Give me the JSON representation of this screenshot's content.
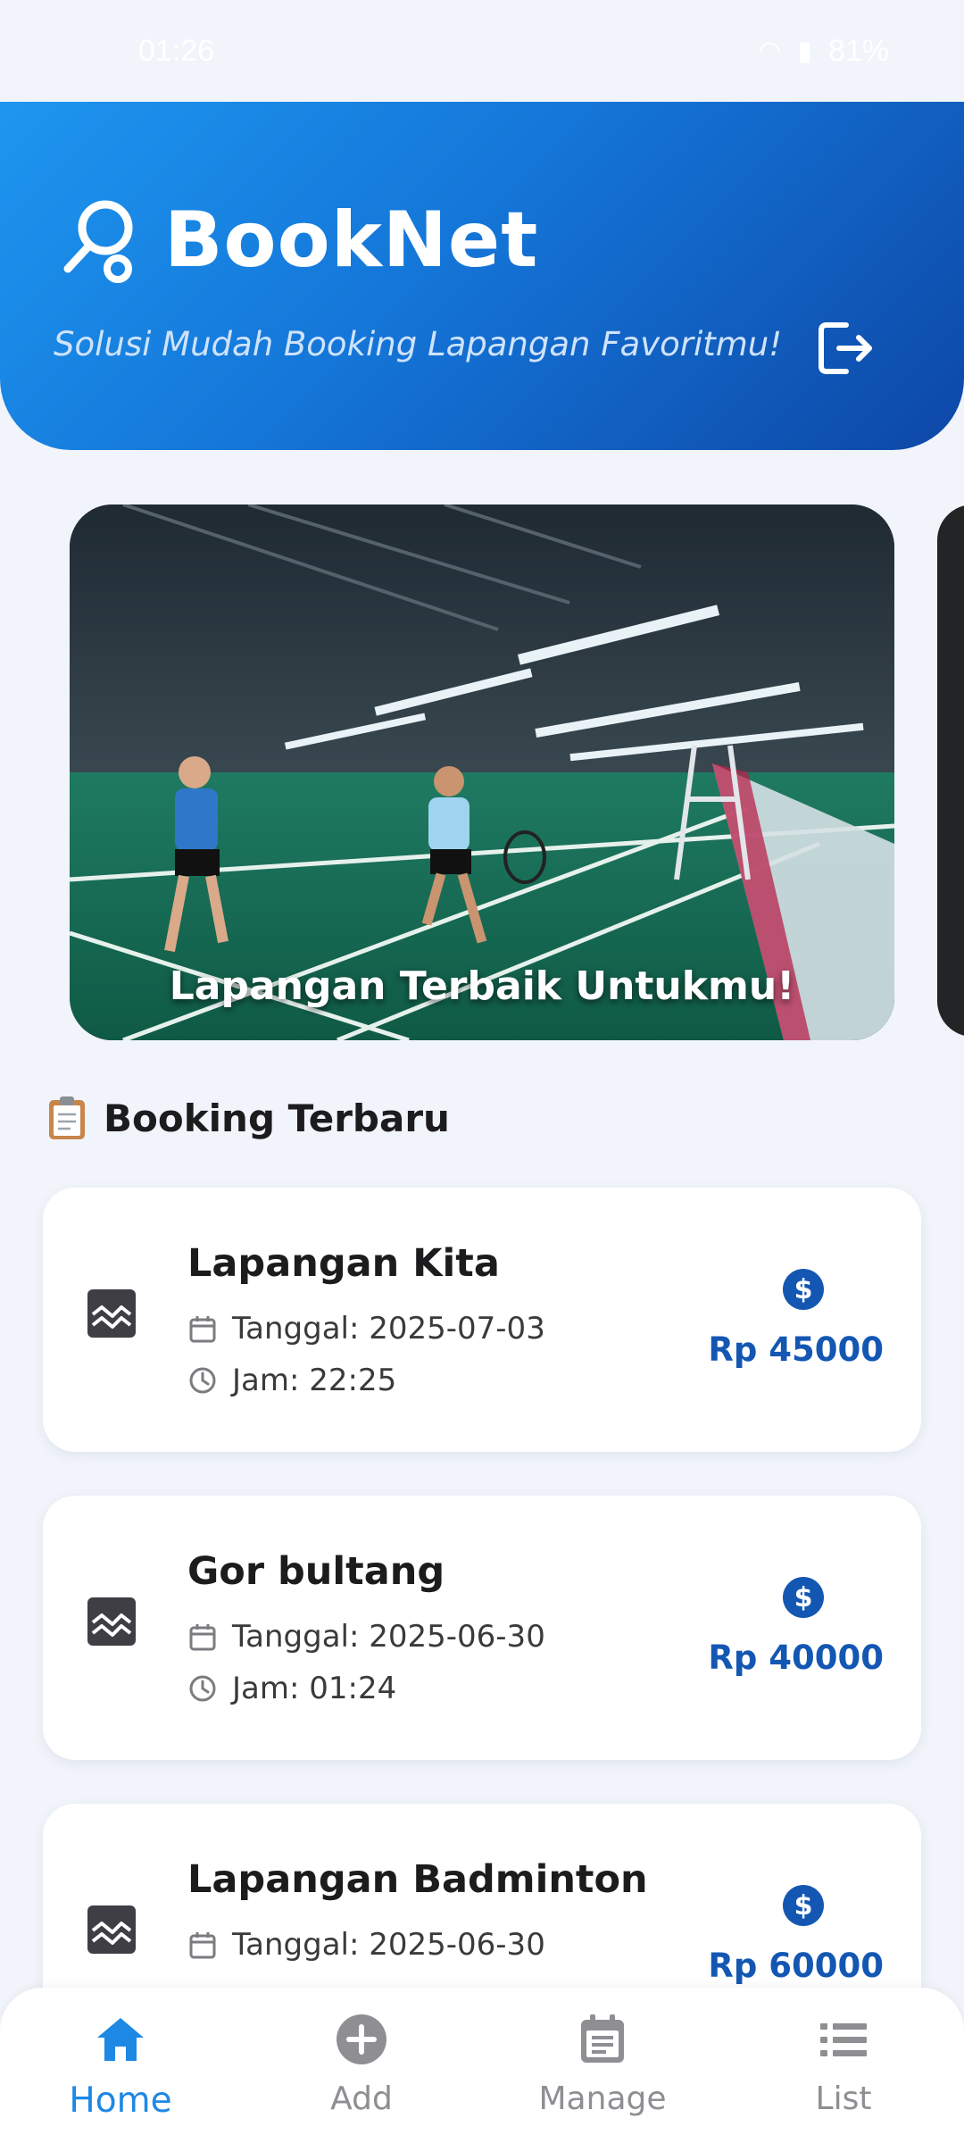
{
  "status_bar": {
    "time": "01:26",
    "battery": "81%"
  },
  "header": {
    "app_name": "BookNet",
    "tagline": "Solusi Mudah Booking Lapangan Favoritmu!",
    "colors": {
      "gradient_start": "#1e96f0",
      "gradient_end": "#0d47a6"
    }
  },
  "banner": {
    "caption": "Lapangan Terbaik Untukmu!"
  },
  "section": {
    "icon": "clipboard-icon",
    "title": "Booking Terbaru"
  },
  "bookings": [
    {
      "name": "Lapangan Kita",
      "date": "Tanggal: 2025-07-03",
      "time": "Jam: 22:25",
      "price": "Rp 45000"
    },
    {
      "name": "Gor bultang",
      "date": "Tanggal: 2025-06-30",
      "time": "Jam: 01:24",
      "price": "Rp 40000"
    },
    {
      "name": "Lapangan Badminton",
      "date": "Tanggal: 2025-06-30",
      "time": "",
      "price": "Rp 60000"
    }
  ],
  "nav": {
    "items": [
      {
        "label": "Home",
        "icon": "home-icon",
        "active": true
      },
      {
        "label": "Add",
        "icon": "add-circle-icon",
        "active": false
      },
      {
        "label": "Manage",
        "icon": "calendar-note-icon",
        "active": false
      },
      {
        "label": "List",
        "icon": "list-icon",
        "active": false
      }
    ],
    "colors": {
      "active": "#1e88e5",
      "inactive": "#8e8e93"
    }
  }
}
